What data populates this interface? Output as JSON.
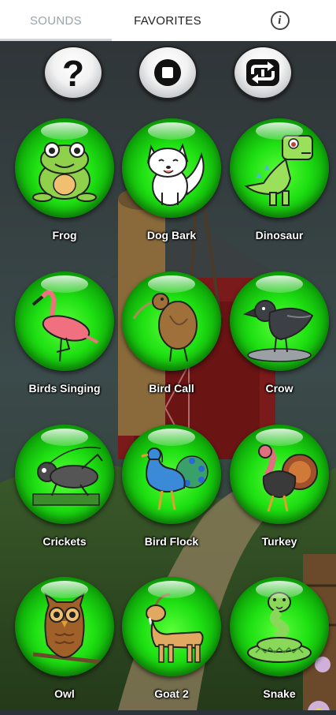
{
  "tabs": {
    "sounds": "SOUNDS",
    "favorites": "FAVORITES",
    "info_icon": "info-icon"
  },
  "controls": [
    {
      "name": "help",
      "icon": "question-icon"
    },
    {
      "name": "stop",
      "icon": "stop-icon"
    },
    {
      "name": "repeat",
      "icon": "repeat-icon"
    }
  ],
  "sounds": [
    {
      "label": "Frog",
      "icon": "frog-icon"
    },
    {
      "label": "Dog Bark",
      "icon": "dog-icon"
    },
    {
      "label": "Dinosaur",
      "icon": "dinosaur-icon"
    },
    {
      "label": "Birds Singing",
      "icon": "flamingo-icon"
    },
    {
      "label": "Bird Call",
      "icon": "kiwi-icon"
    },
    {
      "label": "Crow",
      "icon": "crow-icon"
    },
    {
      "label": "Crickets",
      "icon": "cricket-icon"
    },
    {
      "label": "Bird Flock",
      "icon": "peacock-icon"
    },
    {
      "label": "Turkey",
      "icon": "turkey-icon"
    },
    {
      "label": "Owl",
      "icon": "owl-icon"
    },
    {
      "label": "Goat 2",
      "icon": "goat-icon"
    },
    {
      "label": "Snake",
      "icon": "snake-icon"
    }
  ],
  "colors": {
    "ball_green": "#1ee012",
    "tab_active": "#cfd6da"
  }
}
